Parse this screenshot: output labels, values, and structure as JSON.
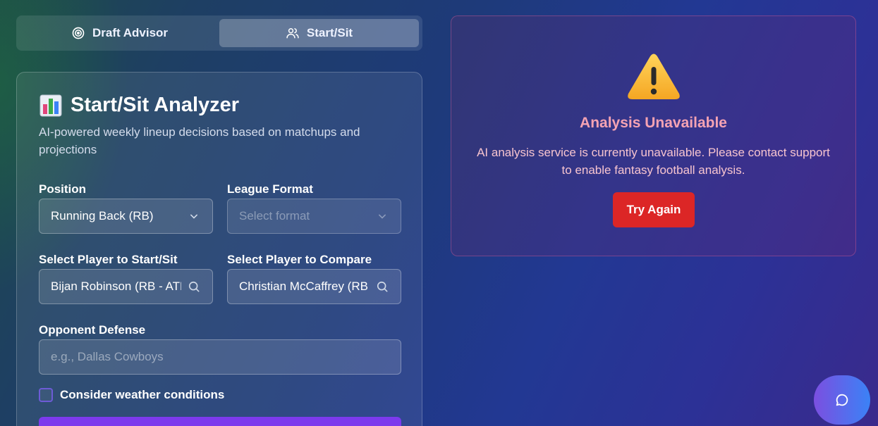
{
  "tabs": [
    {
      "label": "Draft Advisor",
      "icon": "target-icon",
      "active": false
    },
    {
      "label": "Start/Sit",
      "icon": "users-icon",
      "active": true
    }
  ],
  "analyzer": {
    "title": "Start/Sit Analyzer",
    "title_icon": "bar-chart-icon",
    "subtitle": "AI-powered weekly lineup decisions based on matchups and projections",
    "position": {
      "label": "Position",
      "value": "Running Back (RB)"
    },
    "league_format": {
      "label": "League Format",
      "placeholder": "Select format"
    },
    "player_start": {
      "label": "Select Player to Start/Sit",
      "value": "Bijan Robinson (RB - ATL)"
    },
    "player_compare": {
      "label": "Select Player to Compare",
      "value": "Christian McCaffrey (RB - SF)"
    },
    "opponent": {
      "label": "Opponent Defense",
      "placeholder": "e.g., Dallas Cowboys"
    },
    "weather": {
      "label": "Consider weather conditions",
      "checked": false
    }
  },
  "alert": {
    "icon": "warning-icon",
    "title": "Analysis Unavailable",
    "message": "AI analysis service is currently unavailable. Please contact support to enable fantasy football analysis.",
    "retry_label": "Try Again"
  },
  "colors": {
    "accent": "#7c3aed",
    "danger": "#dc2626",
    "alert_title": "#f5a3b3"
  }
}
